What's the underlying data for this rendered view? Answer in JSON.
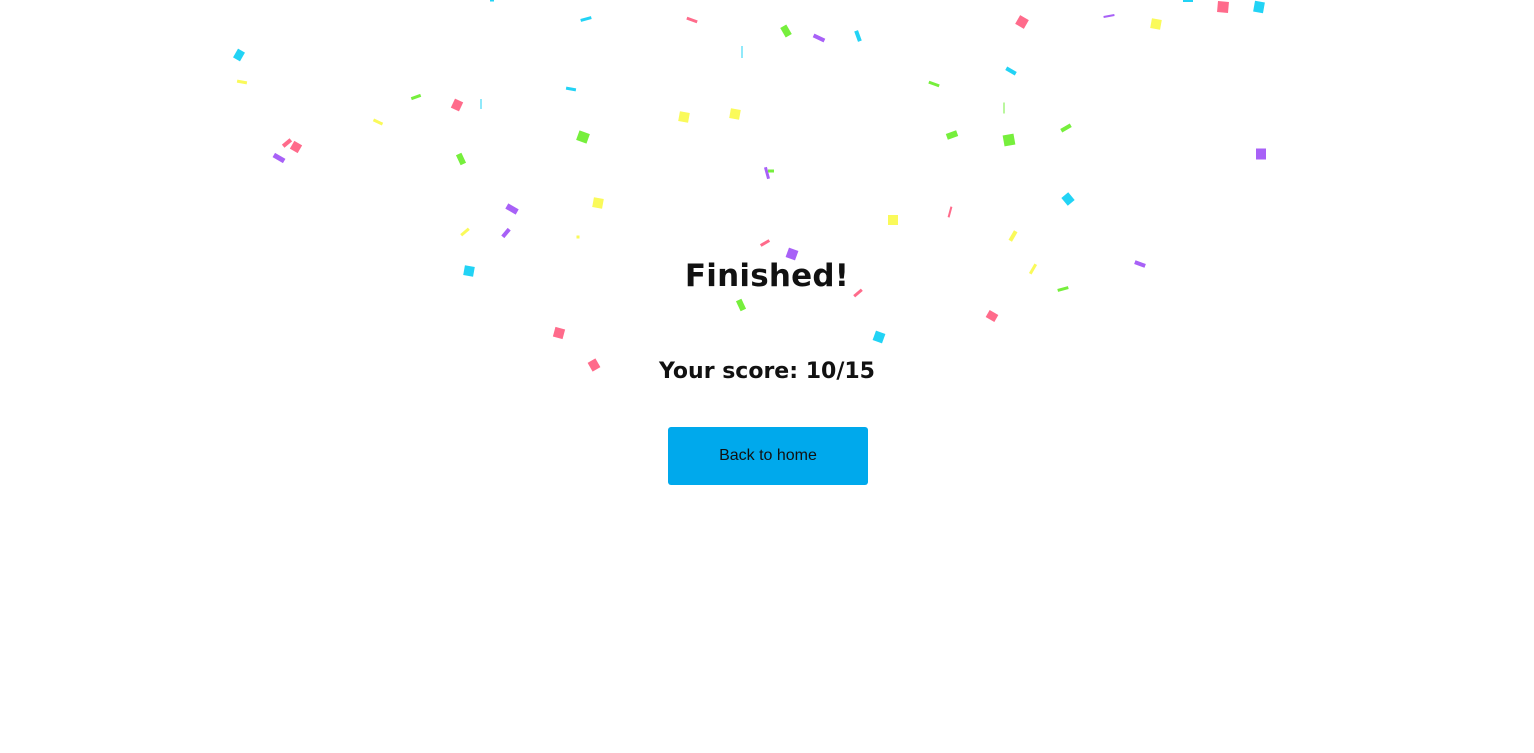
{
  "result": {
    "title": "Finished!",
    "score_label": "Your score: ",
    "score_value": "10/15"
  },
  "actions": {
    "back_home_label": "Back to home"
  },
  "colors": {
    "button_bg": "#00a9ec",
    "text": "#111111",
    "confetti": [
      "#ff6b8b",
      "#22d3f5",
      "#76ef3c",
      "#fafa5a",
      "#a861f7"
    ]
  }
}
